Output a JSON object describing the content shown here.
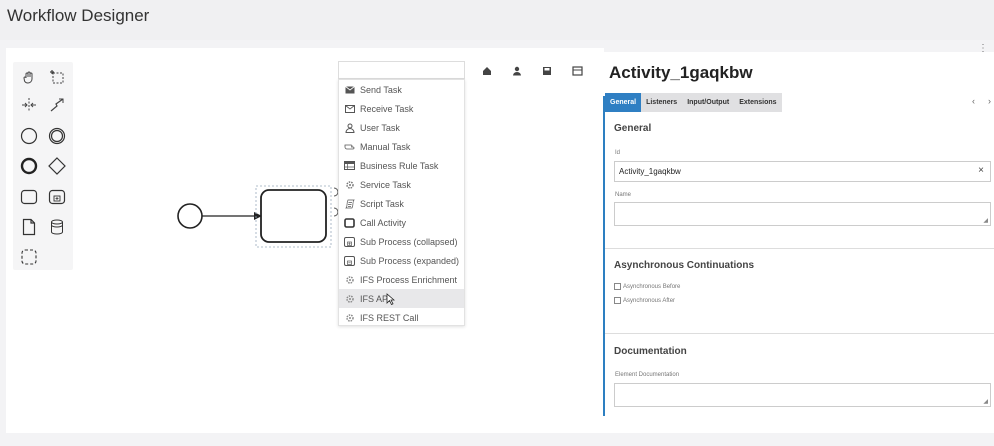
{
  "app": {
    "title": "Workflow Designer"
  },
  "palette": {
    "tools": [
      {
        "name": "hand-tool-icon"
      },
      {
        "name": "lasso-tool-icon"
      },
      {
        "name": "space-tool-icon"
      },
      {
        "name": "connect-tool-icon"
      },
      {
        "name": "start-event-icon"
      },
      {
        "name": "intermediate-event-icon"
      },
      {
        "name": "end-event-icon"
      },
      {
        "name": "gateway-icon"
      },
      {
        "name": "task-icon"
      },
      {
        "name": "subprocess-icon"
      },
      {
        "name": "data-object-icon"
      },
      {
        "name": "data-store-icon"
      },
      {
        "name": "group-icon"
      }
    ]
  },
  "toolbar": {
    "buttons": [
      "home-icon",
      "user-icon",
      "save-icon",
      "layout-icon"
    ]
  },
  "replace_menu": {
    "search_value": "",
    "items": [
      {
        "label": "Send Task",
        "icon": "send-task-icon"
      },
      {
        "label": "Receive Task",
        "icon": "receive-task-icon"
      },
      {
        "label": "User Task",
        "icon": "user-task-icon"
      },
      {
        "label": "Manual Task",
        "icon": "manual-task-icon"
      },
      {
        "label": "Business Rule Task",
        "icon": "business-rule-task-icon"
      },
      {
        "label": "Service Task",
        "icon": "service-task-icon"
      },
      {
        "label": "Script Task",
        "icon": "script-task-icon"
      },
      {
        "label": "Call Activity",
        "icon": "call-activity-icon"
      },
      {
        "label": "Sub Process (collapsed)",
        "icon": "subprocess-collapsed-icon"
      },
      {
        "label": "Sub Process (expanded)",
        "icon": "subprocess-expanded-icon"
      },
      {
        "label": "IFS Process Enrichment",
        "icon": "gear-icon"
      },
      {
        "label": "IFS API",
        "icon": "gear-icon",
        "hovered": true
      },
      {
        "label": "IFS REST Call",
        "icon": "gear-icon"
      }
    ]
  },
  "properties": {
    "title": "Activity_1gaqkbw",
    "tabs": [
      {
        "label": "General",
        "active": true
      },
      {
        "label": "Listeners"
      },
      {
        "label": "Input/Output"
      },
      {
        "label": "Extensions"
      }
    ],
    "general": {
      "heading": "General",
      "id_label": "Id",
      "id_value": "Activity_1gaqkbw",
      "clear_symbol": "×",
      "name_label": "Name",
      "name_value": ""
    },
    "async": {
      "heading": "Asynchronous Continuations",
      "before_label": "Asynchronous Before",
      "after_label": "Asynchronous After",
      "before_checked": false,
      "after_checked": false
    },
    "documentation": {
      "heading": "Documentation",
      "label": "Element Documentation",
      "value": ""
    }
  },
  "colors": {
    "accent": "#2f7fc3",
    "canvas_bg": "#ffffff",
    "header_bg": "#f0f0f2"
  }
}
